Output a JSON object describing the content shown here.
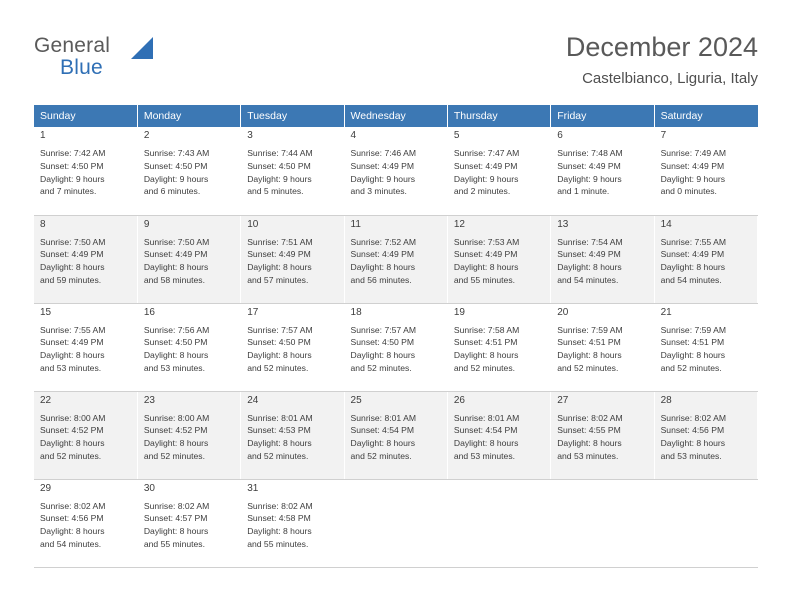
{
  "logo": {
    "line1": "General",
    "line2": "Blue"
  },
  "header": {
    "title": "December 2024",
    "subtitle": "Castelbianco, Liguria, Italy"
  },
  "weekdays": [
    "Sunday",
    "Monday",
    "Tuesday",
    "Wednesday",
    "Thursday",
    "Friday",
    "Saturday"
  ],
  "colors": {
    "header_bg": "#3c78b4",
    "accent": "#2f6fb5",
    "shaded_row": "#f2f2f2"
  },
  "weeks": [
    [
      {
        "day": "1",
        "sunrise": "Sunrise: 7:42 AM",
        "sunset": "Sunset: 4:50 PM",
        "daylight1": "Daylight: 9 hours",
        "daylight2": "and 7 minutes."
      },
      {
        "day": "2",
        "sunrise": "Sunrise: 7:43 AM",
        "sunset": "Sunset: 4:50 PM",
        "daylight1": "Daylight: 9 hours",
        "daylight2": "and 6 minutes."
      },
      {
        "day": "3",
        "sunrise": "Sunrise: 7:44 AM",
        "sunset": "Sunset: 4:50 PM",
        "daylight1": "Daylight: 9 hours",
        "daylight2": "and 5 minutes."
      },
      {
        "day": "4",
        "sunrise": "Sunrise: 7:46 AM",
        "sunset": "Sunset: 4:49 PM",
        "daylight1": "Daylight: 9 hours",
        "daylight2": "and 3 minutes."
      },
      {
        "day": "5",
        "sunrise": "Sunrise: 7:47 AM",
        "sunset": "Sunset: 4:49 PM",
        "daylight1": "Daylight: 9 hours",
        "daylight2": "and 2 minutes."
      },
      {
        "day": "6",
        "sunrise": "Sunrise: 7:48 AM",
        "sunset": "Sunset: 4:49 PM",
        "daylight1": "Daylight: 9 hours",
        "daylight2": "and 1 minute."
      },
      {
        "day": "7",
        "sunrise": "Sunrise: 7:49 AM",
        "sunset": "Sunset: 4:49 PM",
        "daylight1": "Daylight: 9 hours",
        "daylight2": "and 0 minutes."
      }
    ],
    [
      {
        "day": "8",
        "sunrise": "Sunrise: 7:50 AM",
        "sunset": "Sunset: 4:49 PM",
        "daylight1": "Daylight: 8 hours",
        "daylight2": "and 59 minutes."
      },
      {
        "day": "9",
        "sunrise": "Sunrise: 7:50 AM",
        "sunset": "Sunset: 4:49 PM",
        "daylight1": "Daylight: 8 hours",
        "daylight2": "and 58 minutes."
      },
      {
        "day": "10",
        "sunrise": "Sunrise: 7:51 AM",
        "sunset": "Sunset: 4:49 PM",
        "daylight1": "Daylight: 8 hours",
        "daylight2": "and 57 minutes."
      },
      {
        "day": "11",
        "sunrise": "Sunrise: 7:52 AM",
        "sunset": "Sunset: 4:49 PM",
        "daylight1": "Daylight: 8 hours",
        "daylight2": "and 56 minutes."
      },
      {
        "day": "12",
        "sunrise": "Sunrise: 7:53 AM",
        "sunset": "Sunset: 4:49 PM",
        "daylight1": "Daylight: 8 hours",
        "daylight2": "and 55 minutes."
      },
      {
        "day": "13",
        "sunrise": "Sunrise: 7:54 AM",
        "sunset": "Sunset: 4:49 PM",
        "daylight1": "Daylight: 8 hours",
        "daylight2": "and 54 minutes."
      },
      {
        "day": "14",
        "sunrise": "Sunrise: 7:55 AM",
        "sunset": "Sunset: 4:49 PM",
        "daylight1": "Daylight: 8 hours",
        "daylight2": "and 54 minutes."
      }
    ],
    [
      {
        "day": "15",
        "sunrise": "Sunrise: 7:55 AM",
        "sunset": "Sunset: 4:49 PM",
        "daylight1": "Daylight: 8 hours",
        "daylight2": "and 53 minutes."
      },
      {
        "day": "16",
        "sunrise": "Sunrise: 7:56 AM",
        "sunset": "Sunset: 4:50 PM",
        "daylight1": "Daylight: 8 hours",
        "daylight2": "and 53 minutes."
      },
      {
        "day": "17",
        "sunrise": "Sunrise: 7:57 AM",
        "sunset": "Sunset: 4:50 PM",
        "daylight1": "Daylight: 8 hours",
        "daylight2": "and 52 minutes."
      },
      {
        "day": "18",
        "sunrise": "Sunrise: 7:57 AM",
        "sunset": "Sunset: 4:50 PM",
        "daylight1": "Daylight: 8 hours",
        "daylight2": "and 52 minutes."
      },
      {
        "day": "19",
        "sunrise": "Sunrise: 7:58 AM",
        "sunset": "Sunset: 4:51 PM",
        "daylight1": "Daylight: 8 hours",
        "daylight2": "and 52 minutes."
      },
      {
        "day": "20",
        "sunrise": "Sunrise: 7:59 AM",
        "sunset": "Sunset: 4:51 PM",
        "daylight1": "Daylight: 8 hours",
        "daylight2": "and 52 minutes."
      },
      {
        "day": "21",
        "sunrise": "Sunrise: 7:59 AM",
        "sunset": "Sunset: 4:51 PM",
        "daylight1": "Daylight: 8 hours",
        "daylight2": "and 52 minutes."
      }
    ],
    [
      {
        "day": "22",
        "sunrise": "Sunrise: 8:00 AM",
        "sunset": "Sunset: 4:52 PM",
        "daylight1": "Daylight: 8 hours",
        "daylight2": "and 52 minutes."
      },
      {
        "day": "23",
        "sunrise": "Sunrise: 8:00 AM",
        "sunset": "Sunset: 4:52 PM",
        "daylight1": "Daylight: 8 hours",
        "daylight2": "and 52 minutes."
      },
      {
        "day": "24",
        "sunrise": "Sunrise: 8:01 AM",
        "sunset": "Sunset: 4:53 PM",
        "daylight1": "Daylight: 8 hours",
        "daylight2": "and 52 minutes."
      },
      {
        "day": "25",
        "sunrise": "Sunrise: 8:01 AM",
        "sunset": "Sunset: 4:54 PM",
        "daylight1": "Daylight: 8 hours",
        "daylight2": "and 52 minutes."
      },
      {
        "day": "26",
        "sunrise": "Sunrise: 8:01 AM",
        "sunset": "Sunset: 4:54 PM",
        "daylight1": "Daylight: 8 hours",
        "daylight2": "and 53 minutes."
      },
      {
        "day": "27",
        "sunrise": "Sunrise: 8:02 AM",
        "sunset": "Sunset: 4:55 PM",
        "daylight1": "Daylight: 8 hours",
        "daylight2": "and 53 minutes."
      },
      {
        "day": "28",
        "sunrise": "Sunrise: 8:02 AM",
        "sunset": "Sunset: 4:56 PM",
        "daylight1": "Daylight: 8 hours",
        "daylight2": "and 53 minutes."
      }
    ],
    [
      {
        "day": "29",
        "sunrise": "Sunrise: 8:02 AM",
        "sunset": "Sunset: 4:56 PM",
        "daylight1": "Daylight: 8 hours",
        "daylight2": "and 54 minutes."
      },
      {
        "day": "30",
        "sunrise": "Sunrise: 8:02 AM",
        "sunset": "Sunset: 4:57 PM",
        "daylight1": "Daylight: 8 hours",
        "daylight2": "and 55 minutes."
      },
      {
        "day": "31",
        "sunrise": "Sunrise: 8:02 AM",
        "sunset": "Sunset: 4:58 PM",
        "daylight1": "Daylight: 8 hours",
        "daylight2": "and 55 minutes."
      },
      null,
      null,
      null,
      null
    ]
  ]
}
